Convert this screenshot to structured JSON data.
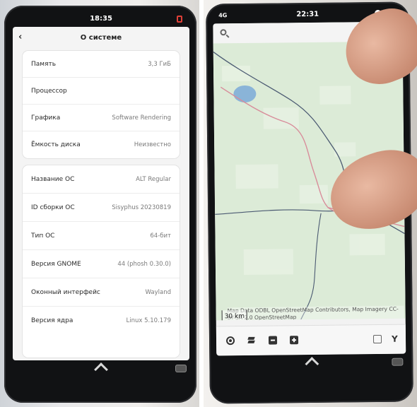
{
  "left_phone": {
    "status": {
      "time": "18:35"
    },
    "header": {
      "title": "О системе"
    },
    "hardware": [
      {
        "label": "Память",
        "value": "3,3 ГиБ"
      },
      {
        "label": "Процессор",
        "value": ""
      },
      {
        "label": "Графика",
        "value": "Software Rendering"
      },
      {
        "label": "Ёмкость диска",
        "value": "Неизвестно"
      }
    ],
    "os": [
      {
        "label": "Название ОС",
        "value": "ALT Regular"
      },
      {
        "label": "ID сборки ОС",
        "value": "Sisyphus 20230819"
      },
      {
        "label": "Тип ОС",
        "value": "64-бит"
      },
      {
        "label": "Версия GNOME",
        "value": "44 (phosh 0.30.0)"
      },
      {
        "label": "Оконный интерфейс",
        "value": "Wayland"
      },
      {
        "label": "Версия ядра",
        "value": "Linux 5.10.179"
      }
    ]
  },
  "right_phone": {
    "status": {
      "network": "4G",
      "time": "22:31"
    },
    "map": {
      "attribution_line1": "Map Data ODBL OpenStreetMap Contributors, Map Imagery CC-",
      "attribution_line2": "BY-SA 2.0 OpenStreetMap",
      "scale": "30 km"
    },
    "toolbar": [
      "locate-icon",
      "layers-icon",
      "zoom-out-icon",
      "zoom-in-icon",
      "window-icon",
      "route-icon"
    ]
  },
  "colors": {
    "map_land": "#dcebd7",
    "road": "#d88c9a",
    "border": "#4b5a72",
    "water": "#8ab4d8"
  }
}
